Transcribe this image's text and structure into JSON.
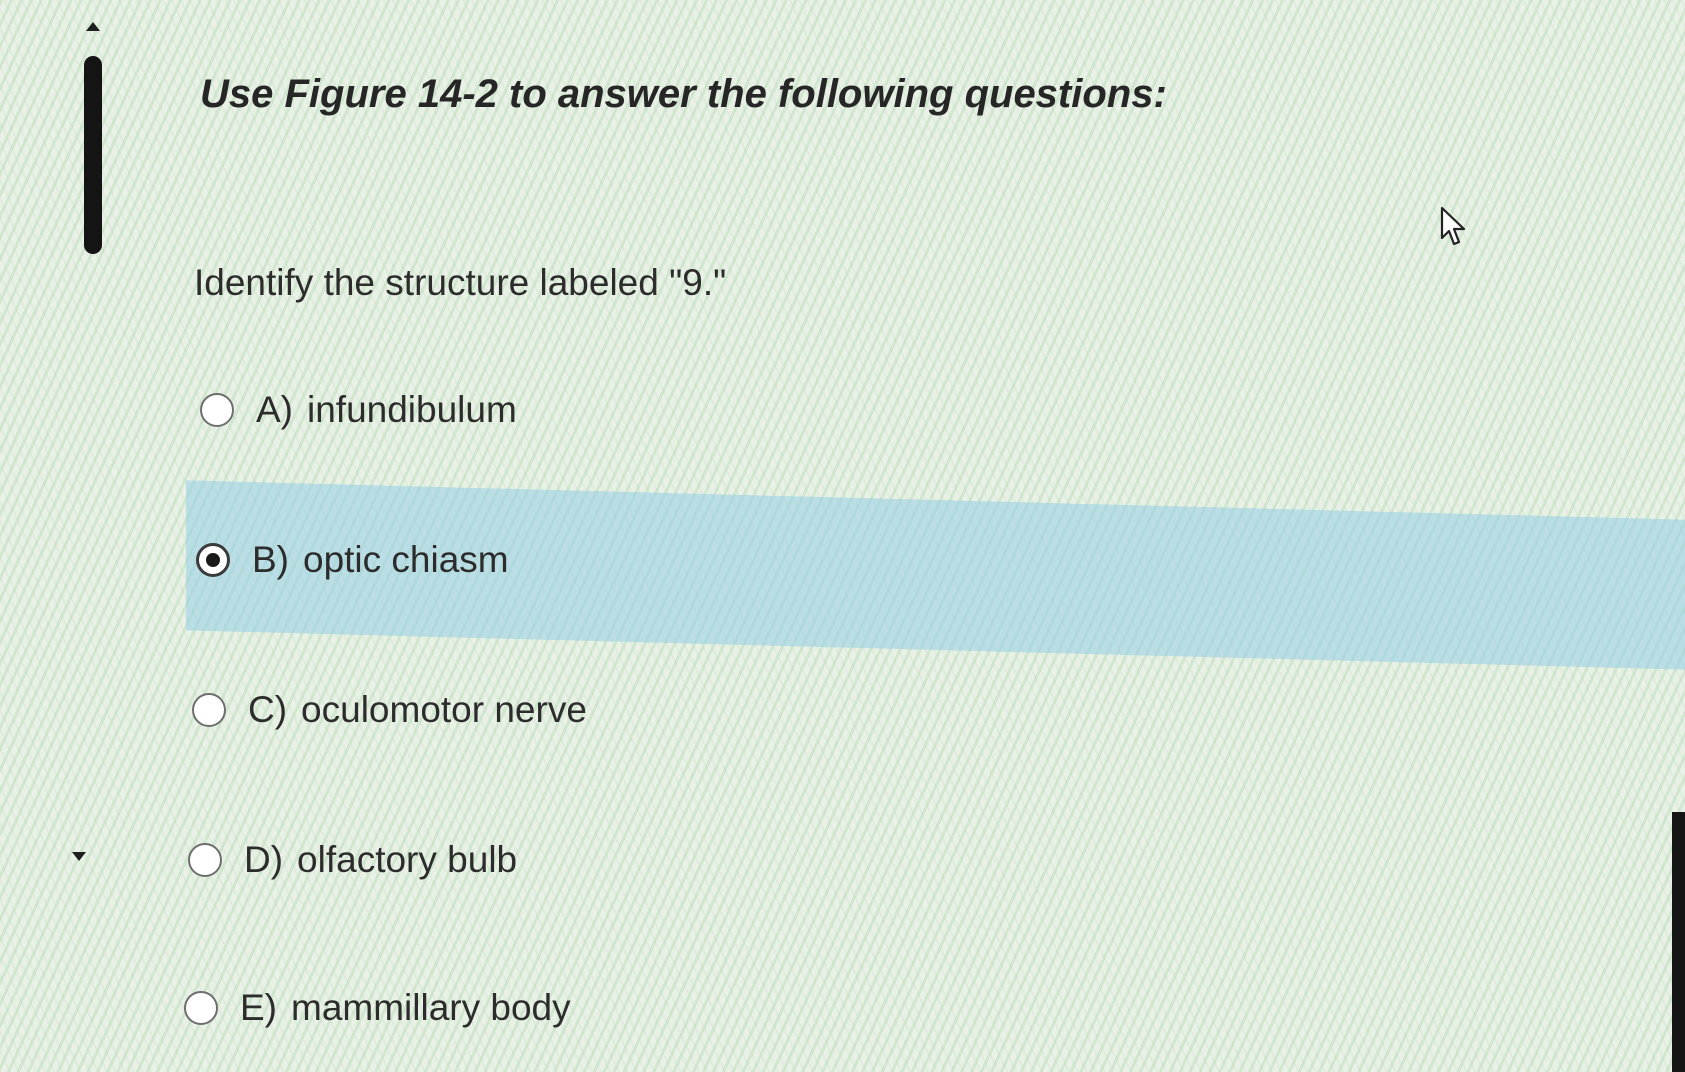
{
  "question": {
    "title": "Use Figure 14-2 to answer the following questions:",
    "prompt": "Identify the structure labeled \"9.\""
  },
  "options": [
    {
      "label": "A)",
      "text": "infundibulum",
      "selected": false
    },
    {
      "label": "B)",
      "text": "optic chiasm",
      "selected": true
    },
    {
      "label": "C)",
      "text": "oculomotor nerve",
      "selected": false
    },
    {
      "label": "D)",
      "text": "olfactory bulb",
      "selected": false
    },
    {
      "label": "E)",
      "text": "mammillary body",
      "selected": false
    }
  ],
  "colors": {
    "selected_highlight": "#96cde6",
    "background": "#e9f1e6",
    "text": "#2c2c2c"
  },
  "icons": {
    "cursor": "mouse-pointer-icon",
    "scroll_up": "scroll-up-arrow-icon",
    "scroll_down": "scroll-down-arrow-icon"
  }
}
